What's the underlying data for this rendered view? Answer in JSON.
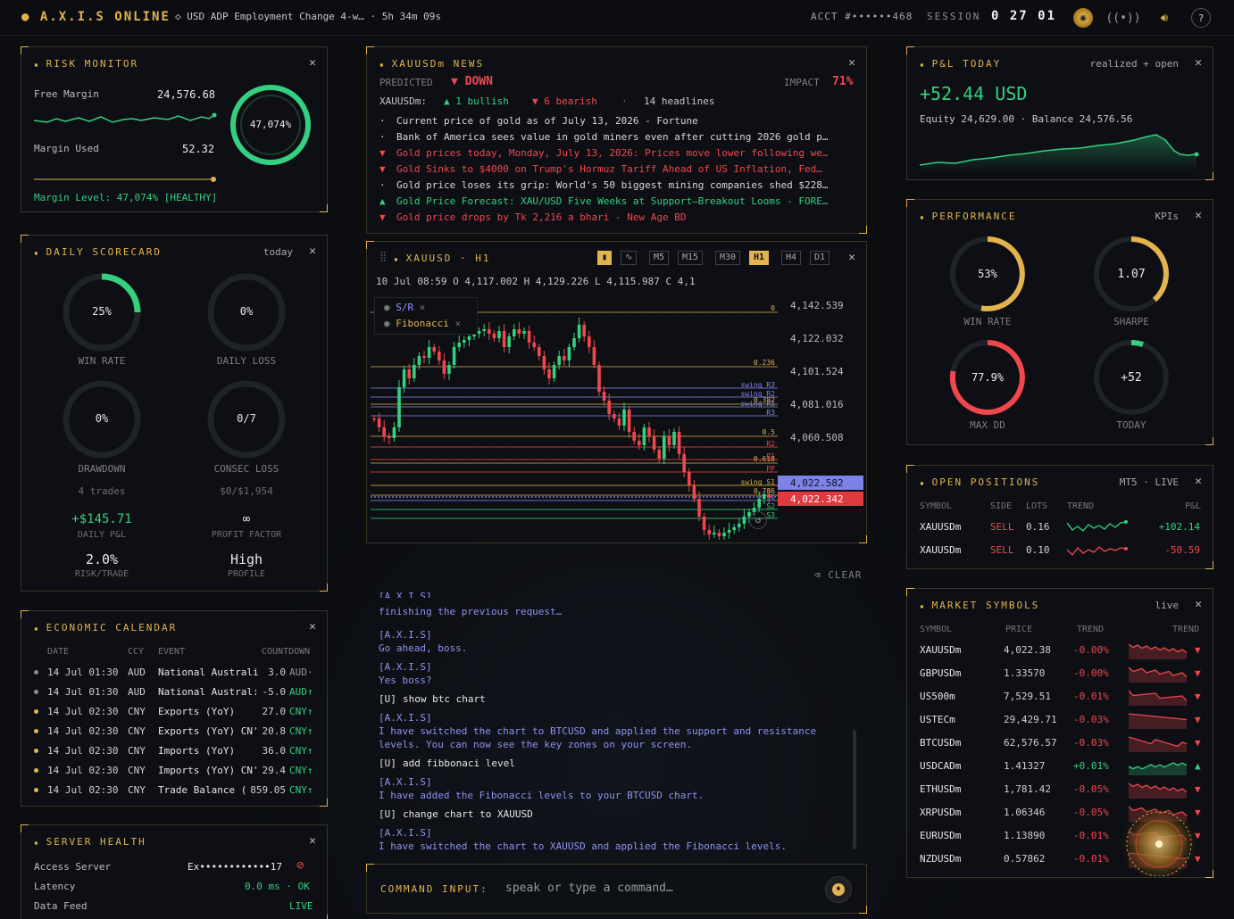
{
  "topbar": {
    "brand": "A.X.I.S ONLINE",
    "event": "◇ USD ADP Employment Change 4-w… · 5h 34m 09s",
    "acct": "ACCT #••••••468",
    "session_label": "SESSION",
    "clock": "0 27 01",
    "help": "?"
  },
  "risk": {
    "title": "RISK MONITOR",
    "free_margin_label": "Free Margin",
    "free_margin": "24,576.68",
    "margin_used_label": "Margin Used",
    "margin_used": "52.32",
    "ring": "47,074%",
    "margin_level_text": "Margin Level: 47,074% [HEALTHY]"
  },
  "news": {
    "title": "XAUUSDm NEWS",
    "predicted_label": "PREDICTED",
    "direction": "▼ DOWN",
    "impact_label": "IMPACT",
    "impact": "71%",
    "symbol": "XAUUSDm:",
    "bullish": "▲ 1 bullish",
    "bearish": "▼ 6 bearish",
    "headlines_count": "14 headlines",
    "items": [
      {
        "bullet": "·",
        "text": "Current price of gold as of July 13, 2026 - Fortune",
        "tone": "white"
      },
      {
        "bullet": "·",
        "text": "Bank of America sees value in gold miners even after cutting 2026 gold p…",
        "tone": "white"
      },
      {
        "bullet": "▼",
        "text": "Gold prices today, Monday, July 13, 2026: Prices move lower following we…",
        "tone": "red"
      },
      {
        "bullet": "▼",
        "text": "Gold Sinks to $4000 on Trump's Hormuz Tariff Ahead of US Inflation, Fed…",
        "tone": "red"
      },
      {
        "bullet": "·",
        "text": "Gold price loses its grip: World's 50 biggest mining companies shed $228…",
        "tone": "white"
      },
      {
        "bullet": "▲",
        "text": "Gold Price Forecast: XAU/USD Five Weeks at Support–Breakout Looms - FORE…",
        "tone": "green"
      },
      {
        "bullet": "▼",
        "text": "Gold price drops by Tk 2,216 a bhari - New Age BD",
        "tone": "red"
      }
    ]
  },
  "pnl": {
    "title": "P&L TODAY",
    "tag": "realized + open",
    "value": "+52.44 USD",
    "sub": "Equity 24,629.00 · Balance 24,576.56"
  },
  "scorecard": {
    "title": "DAILY SCORECARD",
    "tag": "today",
    "win_rate": "25%",
    "win_rate_label": "WIN RATE",
    "daily_loss": "0%",
    "daily_loss_label": "DAILY LOSS",
    "drawdown": "0%",
    "drawdown_label": "DRAWDOWN",
    "consec": "0/7",
    "consec_label": "CONSEC LOSS",
    "trades": "4 trades",
    "loss_budget": "$0/$1,954",
    "daily_pnl": "+$145.71",
    "daily_pnl_label": "DAILY P&L",
    "pf": "∞",
    "pf_label": "PROFIT FACTOR",
    "risk": "2.0%",
    "risk_label": "RISK/TRADE",
    "profile": "High",
    "profile_label": "PROFILE"
  },
  "chart": {
    "symbol": "XAUUSD",
    "tf": "H1",
    "sep": "·",
    "timeframes": [
      "M5",
      "M15",
      "M30",
      "H1",
      "H4",
      "D1"
    ],
    "active_tf": "H1",
    "ohlc": "10 Jul 08:59   O 4,117.002   H 4,129.226   L 4,115.987   C 4,1",
    "layers": [
      "S/R",
      "Fibonacci"
    ],
    "price_ticks": [
      "4,142.539",
      "4,122.032",
      "4,101.524",
      "4,081.016",
      "4,060.508"
    ],
    "price_blue": "4,022.582",
    "price_red": "4,022.342",
    "fib_labels": [
      "0",
      "0.236",
      "0.382",
      "0.5",
      "0.618",
      "0.786"
    ],
    "sr_labels": [
      "swing R3",
      "swing R2",
      "swing R1",
      "R3",
      "R2",
      "R1",
      "PP",
      "swing S1",
      "S1",
      "S2",
      "S3"
    ]
  },
  "performance": {
    "title": "PERFORMANCE",
    "tag": "KPIs",
    "win_rate": "53%",
    "win_rate_label": "WIN RATE",
    "sharpe": "1.07",
    "sharpe_label": "SHARPE",
    "max_dd": "77.9%",
    "max_dd_label": "MAX DD",
    "today": "+52",
    "today_label": "TODAY"
  },
  "positions": {
    "title": "OPEN POSITIONS",
    "tag": "MT5 · LIVE",
    "headers": [
      "SYMBOL",
      "SIDE",
      "LOTS",
      "TREND",
      "P&L"
    ],
    "rows": [
      {
        "symbol": "XAUUSDm",
        "side": "SELL",
        "lots": "0.16",
        "pnl": "+102.14",
        "tone": "green"
      },
      {
        "symbol": "XAUUSDm",
        "side": "SELL",
        "lots": "0.10",
        "pnl": "-50.59",
        "tone": "red"
      }
    ]
  },
  "calendar": {
    "title": "ECONOMIC CALENDAR",
    "headers": [
      "DATE",
      "CCY",
      "EVENT",
      "COUNTDOWN"
    ],
    "rows": [
      {
        "date": "14 Jul 01:30",
        "ccy": "AUD",
        "event": "National Australia",
        "val": "3.0",
        "cd": "AUD·",
        "tone": "muted",
        "dot": "#8c8c8c"
      },
      {
        "date": "14 Jul 01:30",
        "ccy": "AUD",
        "event": "National Austral:",
        "val": "-5.0",
        "cd": "AUD↑",
        "tone": "green",
        "dot": "#8c8c8c"
      },
      {
        "date": "14 Jul 02:30",
        "ccy": "CNY",
        "event": "Exports (YoY)",
        "val": "27.0",
        "cd": "CNY↑",
        "tone": "green",
        "dot": "#e2b34e"
      },
      {
        "date": "14 Jul 02:30",
        "ccy": "CNY",
        "event": "Exports (YoY) CN'",
        "val": "20.8",
        "cd": "CNY↑",
        "tone": "green",
        "dot": "#e2b34e"
      },
      {
        "date": "14 Jul 02:30",
        "ccy": "CNY",
        "event": "Imports (YoY)",
        "val": "36.0",
        "cd": "CNY↑",
        "tone": "green",
        "dot": "#e2b34e"
      },
      {
        "date": "14 Jul 02:30",
        "ccy": "CNY",
        "event": "Imports (YoY) CN'",
        "val": "29.4",
        "cd": "CNY↑",
        "tone": "green",
        "dot": "#e2b34e"
      },
      {
        "date": "14 Jul 02:30",
        "ccy": "CNY",
        "event": "Trade Balance (",
        "val": "859.05",
        "cd": "CNY↑",
        "tone": "green",
        "dot": "#e2b34e"
      }
    ]
  },
  "chatlog": {
    "clear": "⌫ CLEAR",
    "lines": [
      {
        "who": "",
        "text": "finishing the previous request…",
        "tone": "blue"
      },
      {
        "who": "[A.X.I.S]",
        "text": "Go ahead, boss.",
        "tone": "blue"
      },
      {
        "who": "[A.X.I.S]",
        "text": "Yes boss?",
        "tone": "blue"
      },
      {
        "who": "[U]",
        "text": "show btc chart",
        "tone": "white"
      },
      {
        "who": "[A.X.I.S]",
        "text": "I have switched the chart to BTCUSD and applied the support and resistance",
        "text2": "levels. You can now see the key zones on your screen.",
        "tone": "blue"
      },
      {
        "who": "[U]",
        "text": "add fibbonaci level",
        "tone": "white"
      },
      {
        "who": "[A.X.I.S]",
        "text": "I have added the Fibonacci levels to your BTCUSD chart.",
        "tone": "blue"
      },
      {
        "who": "[U]",
        "text": "change chart to XAUUSD",
        "tone": "white"
      },
      {
        "who": "[A.X.I.S]",
        "text": "I have switched the chart to XAUUSD and applied the Fibonacci levels.",
        "tone": "blue"
      }
    ]
  },
  "command": {
    "label": "COMMAND INPUT:",
    "placeholder": "speak or type a command…"
  },
  "market": {
    "title": "MARKET SYMBOLS",
    "tag": "live",
    "headers": [
      "SYMBOL",
      "PRICE",
      "TREND",
      "TREND"
    ],
    "rows": [
      {
        "sym": "XAUUSDm",
        "price": "4,022.38",
        "chg": "-0.00%",
        "arrow": "▼",
        "tone": "red"
      },
      {
        "sym": "GBPUSDm",
        "price": "1.33570",
        "chg": "-0.00%",
        "arrow": "▼",
        "tone": "red"
      },
      {
        "sym": "US500m",
        "price": "7,529.51",
        "chg": "-0.01%",
        "arrow": "▼",
        "tone": "red"
      },
      {
        "sym": "USTECm",
        "price": "29,429.71",
        "chg": "-0.03%",
        "arrow": "▼",
        "tone": "red"
      },
      {
        "sym": "BTCUSDm",
        "price": "62,576.57",
        "chg": "-0.03%",
        "arrow": "▼",
        "tone": "red"
      },
      {
        "sym": "USDCADm",
        "price": "1.41327",
        "chg": "+0.01%",
        "arrow": "▲",
        "tone": "green"
      },
      {
        "sym": "ETHUSDm",
        "price": "1,781.42",
        "chg": "-0.05%",
        "arrow": "▼",
        "tone": "red"
      },
      {
        "sym": "XRPUSDm",
        "price": "1.06346",
        "chg": "-0.05%",
        "arrow": "▼",
        "tone": "red"
      },
      {
        "sym": "EURUSDm",
        "price": "1.13890",
        "chg": "-0.01%",
        "arrow": "▼",
        "tone": "red"
      },
      {
        "sym": "NZDUSDm",
        "price": "0.57862",
        "chg": "-0.01%",
        "arrow": "▼",
        "tone": "red"
      }
    ]
  },
  "server": {
    "title": "SERVER HEALTH",
    "access_label": "Access Server",
    "access": "Ex••••••••••••17",
    "latency_label": "Latency",
    "latency": "0.0 ms · OK",
    "feed_label": "Data Feed",
    "feed": "LIVE"
  }
}
